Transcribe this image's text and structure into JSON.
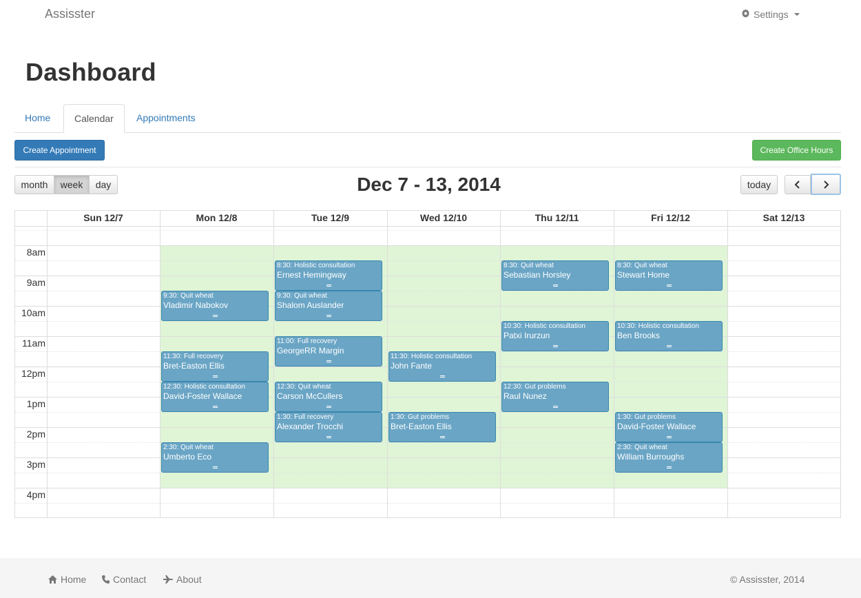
{
  "nav": {
    "brand": "Assisster",
    "settings": "Settings"
  },
  "page": {
    "title": "Dashboard"
  },
  "tabs": [
    "Home",
    "Calendar",
    "Appointments"
  ],
  "actions": {
    "create_appointment": "Create Appointment",
    "create_office_hours": "Create Office Hours"
  },
  "calendar": {
    "views": [
      "month",
      "week",
      "day"
    ],
    "active_view": "week",
    "title": "Dec 7 - 13, 2014",
    "today_label": "today",
    "days": [
      "Sun 12/7",
      "Mon 12/8",
      "Tue 12/9",
      "Wed 12/10",
      "Thu 12/11",
      "Fri 12/12",
      "Sat 12/13"
    ],
    "times": [
      "8am",
      "9am",
      "10am",
      "11am",
      "12pm",
      "1pm",
      "2pm",
      "3pm",
      "4pm"
    ],
    "event_color": "#6aa5c5",
    "office_hours_color": "#dff5d6",
    "events": [
      {
        "day": 1,
        "start": 9.5,
        "time": "9:30: Quit wheat",
        "name": "Vladimir Nabokov"
      },
      {
        "day": 1,
        "start": 11.5,
        "time": "11:30: Full recovery",
        "name": "Bret-Easton Ellis"
      },
      {
        "day": 1,
        "start": 12.5,
        "time": "12:30: Holistic consultation",
        "name": "David-Foster Wallace"
      },
      {
        "day": 1,
        "start": 14.5,
        "time": "2:30: Quit wheat",
        "name": "Umberto Eco"
      },
      {
        "day": 2,
        "start": 8.5,
        "time": "8:30: Holistic consultation",
        "name": "Ernest Hemingway"
      },
      {
        "day": 2,
        "start": 9.5,
        "time": "9:30: Quit wheat",
        "name": "Shalom Auslander"
      },
      {
        "day": 2,
        "start": 11.0,
        "time": "11:00: Full recovery",
        "name": "GeorgeRR Margin"
      },
      {
        "day": 2,
        "start": 12.5,
        "time": "12:30: Quit wheat",
        "name": "Carson McCullers"
      },
      {
        "day": 2,
        "start": 13.5,
        "time": "1:30: Full recovery",
        "name": "Alexander Trocchi"
      },
      {
        "day": 3,
        "start": 11.5,
        "time": "11:30: Holistic consultation",
        "name": "John Fante"
      },
      {
        "day": 3,
        "start": 13.5,
        "time": "1:30: Gut problems",
        "name": "Bret-Easton Ellis"
      },
      {
        "day": 4,
        "start": 8.5,
        "time": "8:30: Quit wheat",
        "name": "Sebastian Horsley"
      },
      {
        "day": 4,
        "start": 10.5,
        "time": "10:30: Holistic consultation",
        "name": "Patxi Irurzun"
      },
      {
        "day": 4,
        "start": 12.5,
        "time": "12:30: Gut problems",
        "name": "Raul Nunez"
      },
      {
        "day": 5,
        "start": 8.5,
        "time": "8:30: Quit wheat",
        "name": "Stewart Home"
      },
      {
        "day": 5,
        "start": 10.5,
        "time": "10:30: Holistic consultation",
        "name": "Ben Brooks"
      },
      {
        "day": 5,
        "start": 13.5,
        "time": "1:30: Gut problems",
        "name": "David-Foster Wallace"
      },
      {
        "day": 5,
        "start": 14.5,
        "time": "2:30: Quit wheat",
        "name": "William Burroughs"
      }
    ]
  },
  "footer": {
    "links": [
      "Home",
      "Contact",
      "About"
    ],
    "copyright": "© Assisster, 2014"
  }
}
